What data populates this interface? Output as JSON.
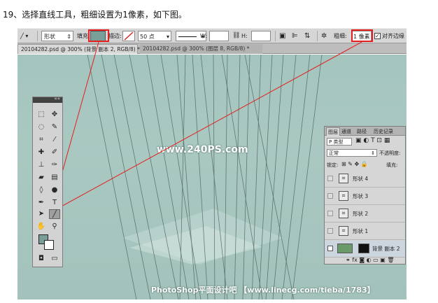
{
  "caption": "19、选择直线工具，粗细设置为1像素，如下图。",
  "options_bar": {
    "tool_mode": "形状",
    "fill_label": "填充:",
    "stroke_label": "描边:",
    "stroke_size": "50 点",
    "w_label": "W:",
    "link_icon": "link-icon",
    "h_label": "H:",
    "weight_label": "粗细:",
    "weight_value": "1 像素",
    "align_edges_label": "对齐边缘",
    "fill_color": "#7a9e98"
  },
  "tabs": [
    "20104282.psd @ 300% (背景 副本 2, RGB/8) *",
    "20104282.psd @ 300% (图层 8, RGB/8) *"
  ],
  "watermark": "www.240PS.com",
  "footer_credit": "PhotoShop平面设计吧 【www.linecg.com/tieba/1783】",
  "toolbox": {
    "foreground_color": "#7a9e98",
    "background_color": "#ffffff"
  },
  "layers_panel": {
    "tabs": [
      "图层",
      "通道",
      "路径",
      "历史记录"
    ],
    "filter_kind": "P 类型",
    "blend_mode": "正常",
    "opacity_label": "不透明度:",
    "lock_label": "锁定:",
    "fill_label": "填充:",
    "layers": [
      {
        "name": "形状 4"
      },
      {
        "name": "形状 3"
      },
      {
        "name": "形状 2"
      },
      {
        "name": "形状 1"
      },
      {
        "name": "背景 副本 2"
      }
    ]
  },
  "colors": {
    "canvas": "#a6c6bf",
    "annotation_red": "#e41e1e"
  }
}
